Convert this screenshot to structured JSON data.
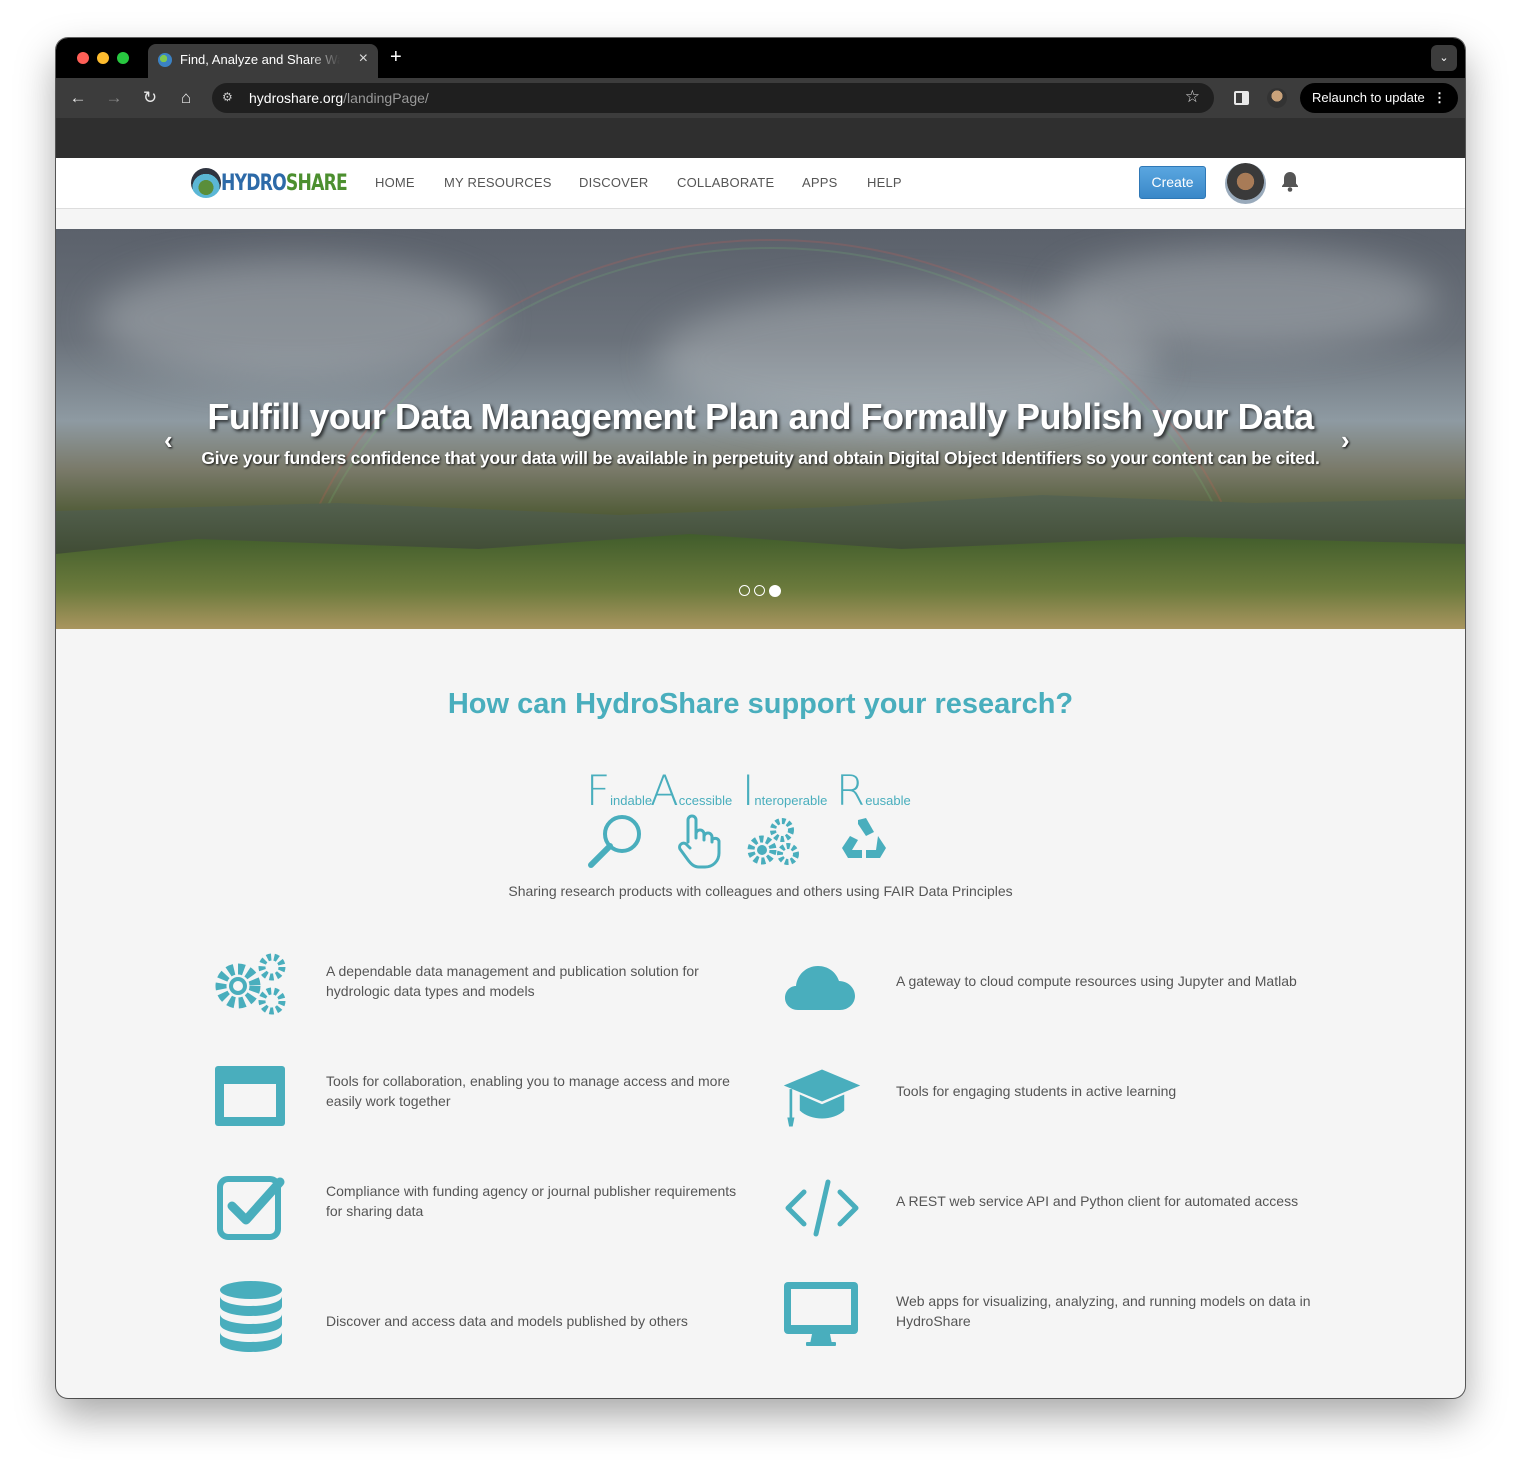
{
  "browser": {
    "tab_title": "Find, Analyze and Share Water Data",
    "new_tab_label": "+",
    "url_domain": "hydroshare.org",
    "url_path": "/landingPage/",
    "relaunch_label": "Relaunch to update"
  },
  "header": {
    "logo_hydro": "HYDRO",
    "logo_share": "SHARE",
    "nav": [
      "HOME",
      "MY RESOURCES",
      "DISCOVER",
      "COLLABORATE",
      "APPS",
      "HELP"
    ],
    "create_label": "Create"
  },
  "hero": {
    "title": "Fulfill your Data Management Plan and Formally Publish your Data",
    "subtitle": "Give your funders confidence that your data will be available in perpetuity and obtain Digital Object Identifiers so your content can be cited.",
    "slide_count": 3,
    "active_slide": 3
  },
  "main": {
    "title": "How can HydroShare support your research?",
    "fair": {
      "words": [
        {
          "letter": "F",
          "rest": "indable",
          "icon": "magnifier-icon"
        },
        {
          "letter": "A",
          "rest": "ccessible",
          "icon": "pointer-hand-icon"
        },
        {
          "letter": "I",
          "rest": "nteroperable",
          "icon": "gears-icon"
        },
        {
          "letter": "R",
          "rest": "eusable",
          "icon": "recycle-icon"
        }
      ],
      "caption": "Sharing research products with colleagues and others using FAIR Data Principles"
    },
    "features": [
      {
        "icon": "gears-icon",
        "text": "A dependable data management and publication solution for hydrologic data types and models"
      },
      {
        "icon": "cloud-icon",
        "text": "A gateway to cloud compute resources using Jupyter and Matlab"
      },
      {
        "icon": "window-icon",
        "text": "Tools for collaboration, enabling you to manage access and more easily work together"
      },
      {
        "icon": "graduation-cap-icon",
        "text": "Tools for engaging students in active learning"
      },
      {
        "icon": "checkbox-icon",
        "text": "Compliance with funding agency or journal publisher requirements for sharing data"
      },
      {
        "icon": "code-icon",
        "text": "A REST web service API and Python client for automated access"
      },
      {
        "icon": "database-icon",
        "text": "Discover and access data and models published by others"
      },
      {
        "icon": "monitor-icon",
        "text": "Web apps for visualizing, analyzing, and running models on data in HydroShare"
      }
    ]
  },
  "colors": {
    "accent": "#49aebd",
    "create_button": "#3a88c8"
  }
}
